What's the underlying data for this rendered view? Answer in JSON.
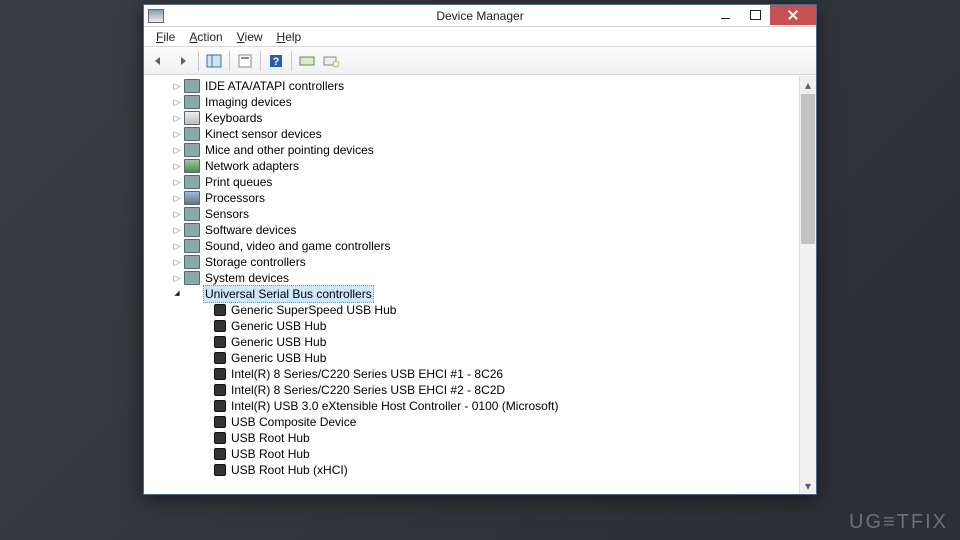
{
  "window": {
    "title": "Device Manager"
  },
  "menu": {
    "file": "File",
    "action": "Action",
    "view": "View",
    "help": "Help"
  },
  "toolbar": {
    "back": "back-arrow",
    "forward": "forward-arrow",
    "show_hide": "show-hide-console-tree",
    "properties": "properties",
    "help": "help",
    "scan": "scan-for-hardware-changes",
    "extra": "toolbar-action"
  },
  "tree": {
    "categories": [
      {
        "label": "IDE ATA/ATAPI controllers",
        "icon": "ide"
      },
      {
        "label": "Imaging devices",
        "icon": "img"
      },
      {
        "label": "Keyboards",
        "icon": "kbd"
      },
      {
        "label": "Kinect sensor devices",
        "icon": "kin"
      },
      {
        "label": "Mice and other pointing devices",
        "icon": "mouse"
      },
      {
        "label": "Network adapters",
        "icon": "nic"
      },
      {
        "label": "Print queues",
        "icon": "prn"
      },
      {
        "label": "Processors",
        "icon": "cpu"
      },
      {
        "label": "Sensors",
        "icon": "sen"
      },
      {
        "label": "Software devices",
        "icon": "sw"
      },
      {
        "label": "Sound, video and game controllers",
        "icon": "snd"
      },
      {
        "label": "Storage controllers",
        "icon": "stor"
      },
      {
        "label": "System devices",
        "icon": "sys"
      }
    ],
    "expanded": {
      "label": "Universal Serial Bus controllers",
      "selected": true,
      "children": [
        "Generic SuperSpeed USB Hub",
        "Generic USB Hub",
        "Generic USB Hub",
        "Generic USB Hub",
        "Intel(R) 8 Series/C220 Series USB EHCI #1 - 8C26",
        "Intel(R) 8 Series/C220 Series USB EHCI #2 - 8C2D",
        "Intel(R) USB 3.0 eXtensible Host Controller - 0100 (Microsoft)",
        "USB Composite Device",
        "USB Root Hub",
        "USB Root Hub",
        "USB Root Hub (xHCI)"
      ]
    }
  },
  "watermark": "UG≡TFIX"
}
